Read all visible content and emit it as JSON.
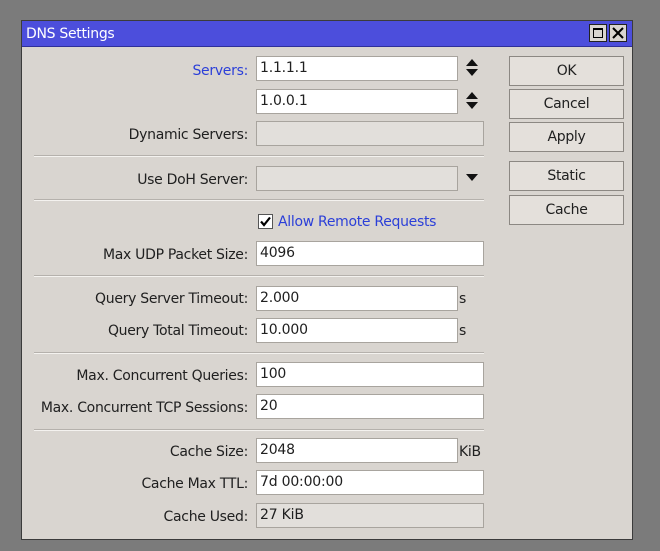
{
  "window": {
    "title": "DNS Settings"
  },
  "servers": {
    "label": "Servers:",
    "values": [
      "1.1.1.1",
      "1.0.0.1"
    ]
  },
  "dynamic_servers": {
    "label": "Dynamic Servers:",
    "value": ""
  },
  "doh": {
    "label": "Use DoH Server:",
    "value": ""
  },
  "allow_remote": {
    "label": "Allow Remote Requests",
    "checked": true
  },
  "max_udp": {
    "label": "Max UDP Packet Size:",
    "value": "4096"
  },
  "query_server_timeout": {
    "label": "Query Server Timeout:",
    "value": "2.000",
    "unit": "s"
  },
  "query_total_timeout": {
    "label": "Query Total Timeout:",
    "value": "10.000",
    "unit": "s"
  },
  "max_concurrent_queries": {
    "label": "Max. Concurrent Queries:",
    "value": "100"
  },
  "max_concurrent_tcp": {
    "label": "Max. Concurrent TCP Sessions:",
    "value": "20"
  },
  "cache_size": {
    "label": "Cache Size:",
    "value": "2048",
    "unit": "KiB"
  },
  "cache_max_ttl": {
    "label": "Cache Max TTL:",
    "value": "7d 00:00:00"
  },
  "cache_used": {
    "label": "Cache Used:",
    "value": "27 KiB"
  },
  "buttons": {
    "ok": "OK",
    "cancel": "Cancel",
    "apply": "Apply",
    "static": "Static",
    "cache": "Cache"
  },
  "colors": {
    "titlebar": "#4c4edc",
    "accent_label": "#2b3fd8",
    "background": "#d9d5d0"
  }
}
